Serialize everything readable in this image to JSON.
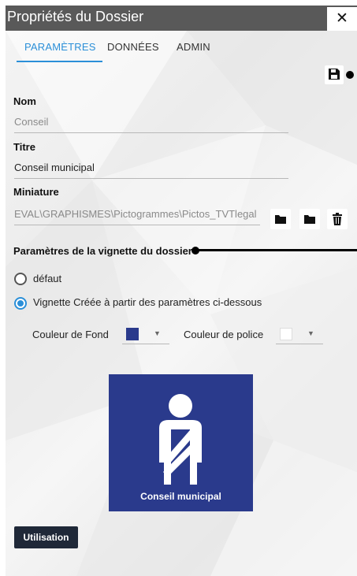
{
  "window": {
    "title": "Propriétés du Dossier",
    "close_glyph": "✕"
  },
  "tabs": [
    {
      "label": "PARAMÈTRES",
      "active": true
    },
    {
      "label": "DONNÉES",
      "active": false
    },
    {
      "label": "ADMIN",
      "active": false
    }
  ],
  "toolbar": {
    "save_icon": "floppy-disk-icon"
  },
  "fields": {
    "nom": {
      "label": "Nom",
      "placeholder": "Conseil"
    },
    "titre": {
      "label": "Titre",
      "value": "Conseil municipal"
    },
    "miniature": {
      "label": "Miniature",
      "value": "EVAL\\GRAPHISMES\\Pictogrammes\\Pictos_TVTlegal",
      "buttons": [
        "folder-icon",
        "folder-icon",
        "trash-icon"
      ]
    }
  },
  "vignette": {
    "section_title": "Paramètres de la vignette du dossier",
    "options": [
      {
        "label": "défaut",
        "selected": false
      },
      {
        "label": "Vignette Créée à partir des paramètres ci-dessous",
        "selected": true
      }
    ],
    "background": {
      "label": "Couleur de Fond",
      "color": "#2a3a8c"
    },
    "font": {
      "label": "Couleur de police",
      "color": "#ffffff"
    }
  },
  "preview": {
    "caption": "Conseil municipal",
    "icon": "mayor-sash-icon"
  },
  "actions": {
    "usage_label": "Utilisation"
  },
  "colors": {
    "accent": "#2b8fd8",
    "titlebar": "#595959",
    "preview_bg": "#2a3a8c",
    "button_dark": "#1f2838"
  }
}
